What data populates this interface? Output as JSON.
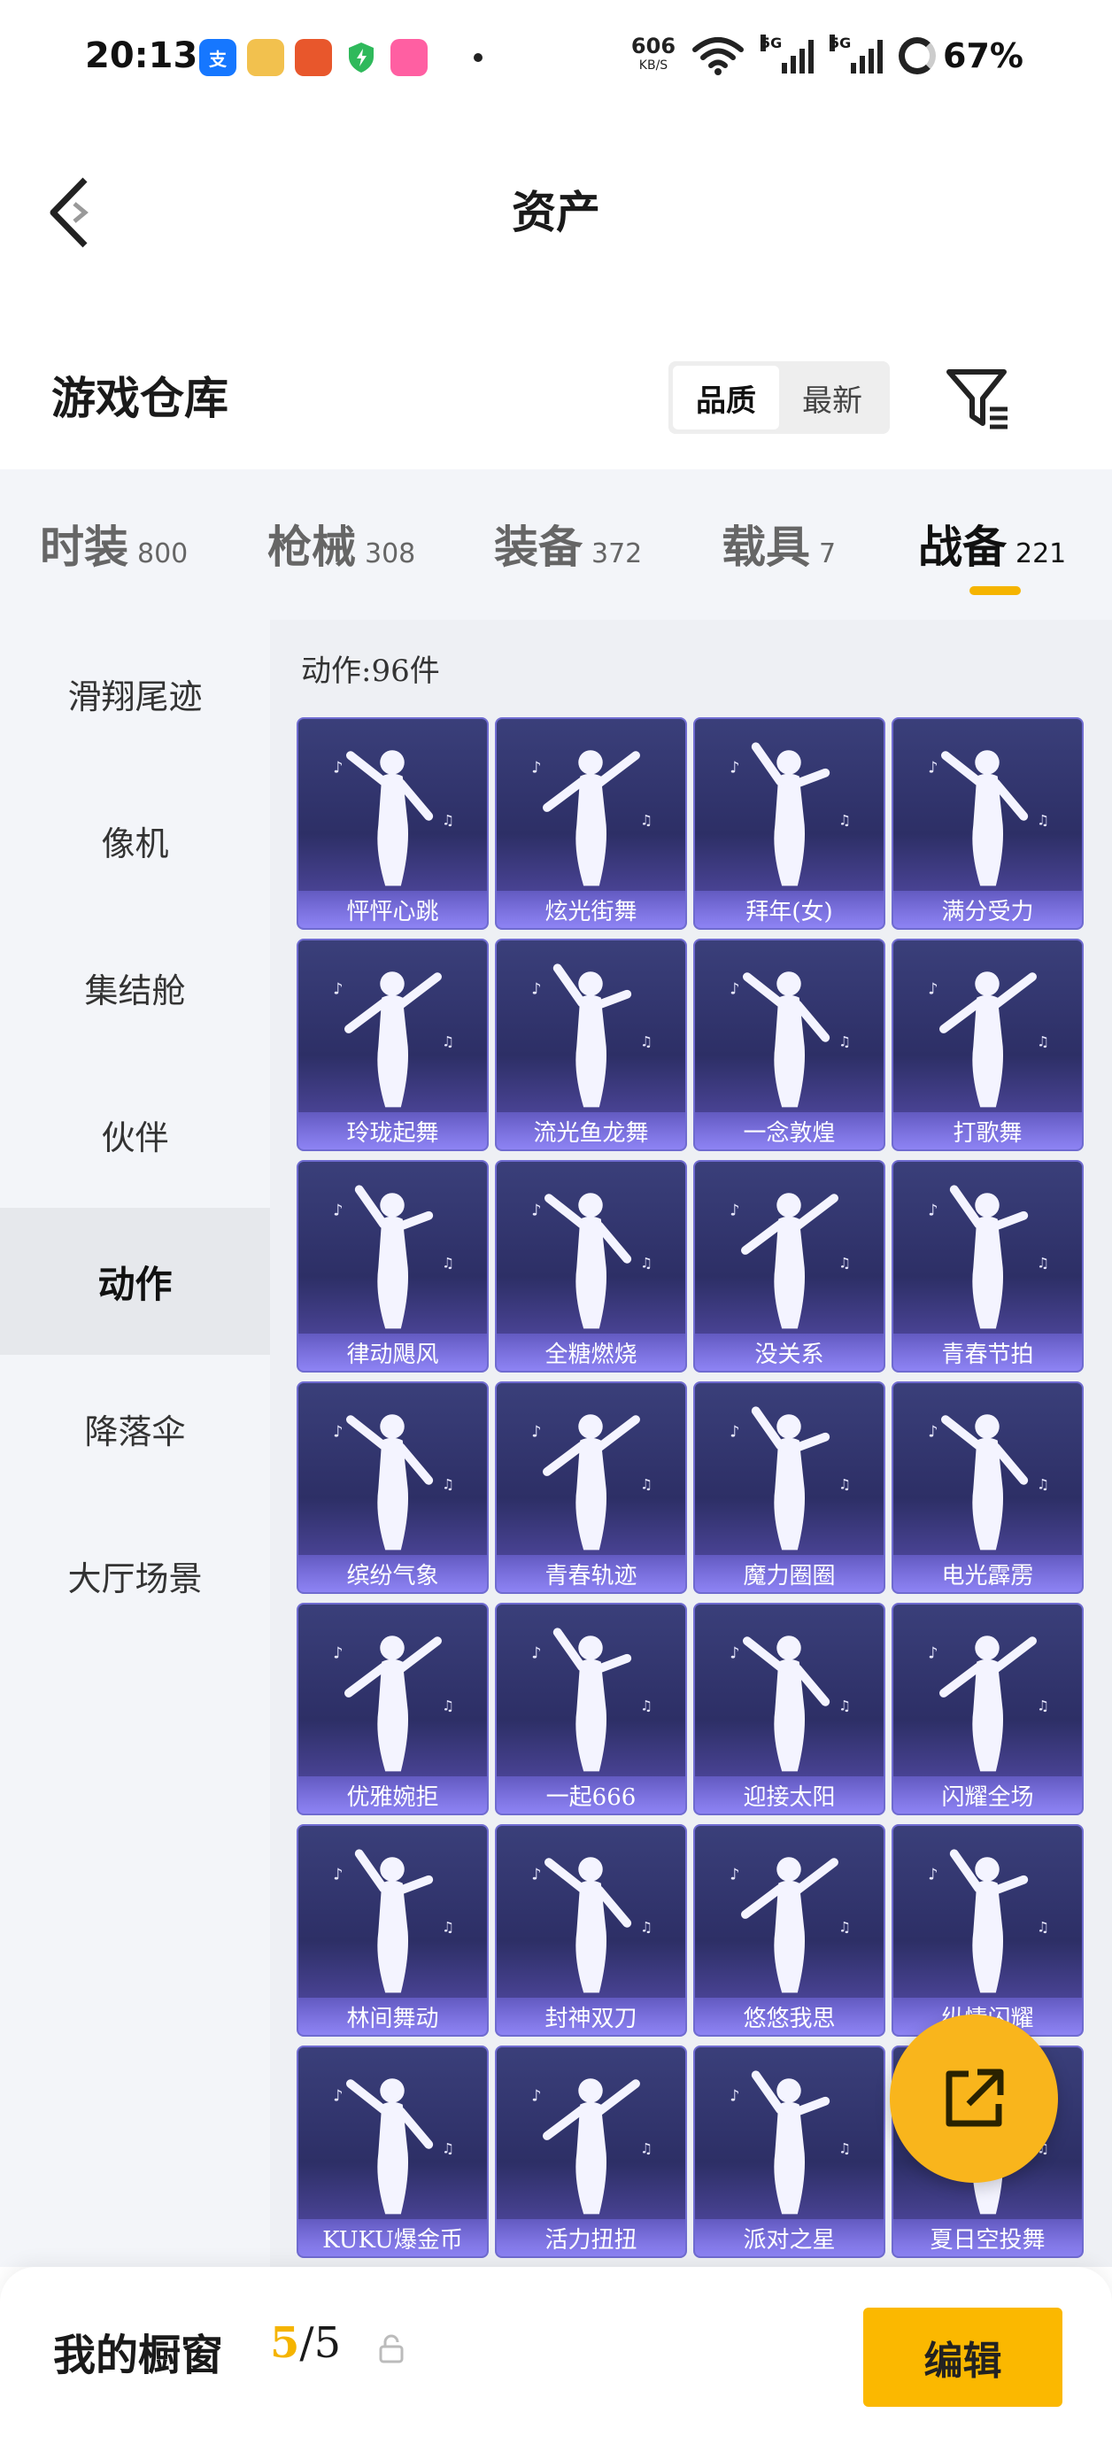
{
  "status_bar": {
    "time": "20:13",
    "net_speed_value": "606",
    "net_speed_unit": "KB/S",
    "signal_1": "5G",
    "signal_2": "5G",
    "battery": "67%"
  },
  "header": {
    "title": "资产"
  },
  "section": {
    "title": "游戏仓库",
    "sort_options": [
      "品质",
      "最新"
    ]
  },
  "tabs": [
    {
      "label": "时装",
      "count": "800"
    },
    {
      "label": "枪械",
      "count": "308"
    },
    {
      "label": "装备",
      "count": "372"
    },
    {
      "label": "载具",
      "count": "7"
    },
    {
      "label": "战备",
      "count": "221"
    }
  ],
  "sidenav": [
    "滑翔尾迹",
    "像机",
    "集结舱",
    "伙伴",
    "动作",
    "降落伞",
    "大厅场景"
  ],
  "content": {
    "count_label": "动作:96件",
    "items": [
      "怦怦心跳",
      "炫光街舞",
      "拜年(女)",
      "满分受力",
      "玲珑起舞",
      "流光鱼龙舞",
      "一念敦煌",
      "打歌舞",
      "律动飓风",
      "全糖燃烧",
      "没关系",
      "青春节拍",
      "缤纷气象",
      "青春轨迹",
      "魔力圈圈",
      "电光霹雳",
      "优雅婉拒",
      "一起666",
      "迎接太阳",
      "闪耀全场",
      "林间舞动",
      "封神双刀",
      "悠悠我思",
      "纵情闪耀",
      "KUKU爆金币",
      "活力扭扭",
      "派对之星",
      "夏日空投舞"
    ]
  },
  "bottom_bar": {
    "label": "我的橱窗",
    "current": "5",
    "total": "/5",
    "edit_label": "编辑"
  }
}
